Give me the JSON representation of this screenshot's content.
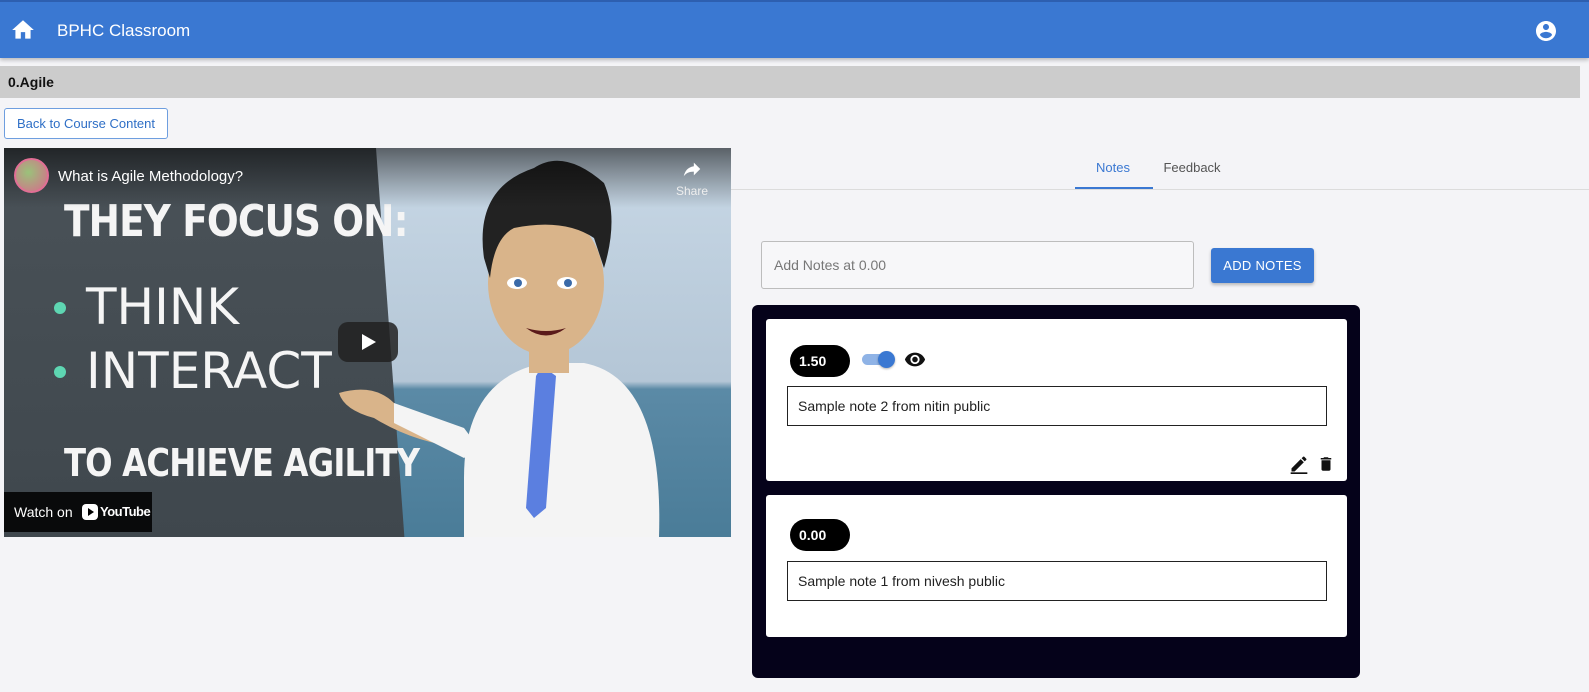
{
  "app": {
    "title": "BPHC Classroom",
    "home_icon": "home-icon",
    "account_icon": "account-circle-icon",
    "brand_color": "#3a78d2"
  },
  "course": {
    "title": "0.Agile"
  },
  "back_button": {
    "label": "Back to Course Content"
  },
  "video": {
    "title": "What is Agile Methodology?",
    "share_label": "Share",
    "watch_on": "Watch on",
    "youtube": "YouTube",
    "frame_text": {
      "line1": "THEY FOCUS ON:",
      "item1": "THINK",
      "item2": "INTERACT",
      "line4": "TO ACHIEVE AGILITY"
    }
  },
  "tabs": [
    {
      "label": "Notes",
      "active": true
    },
    {
      "label": "Feedback",
      "active": false
    }
  ],
  "notes_input": {
    "placeholder": "Add Notes at 0.00",
    "value": ""
  },
  "add_button": {
    "label": "ADD NOTES"
  },
  "notes": [
    {
      "time": "1.50",
      "text": "Sample note 2 from nitin public",
      "visible_toggle": true,
      "editable": true
    },
    {
      "time": "0.00",
      "text": "Sample note 1 from nivesh public",
      "visible_toggle": false,
      "editable": false
    }
  ]
}
